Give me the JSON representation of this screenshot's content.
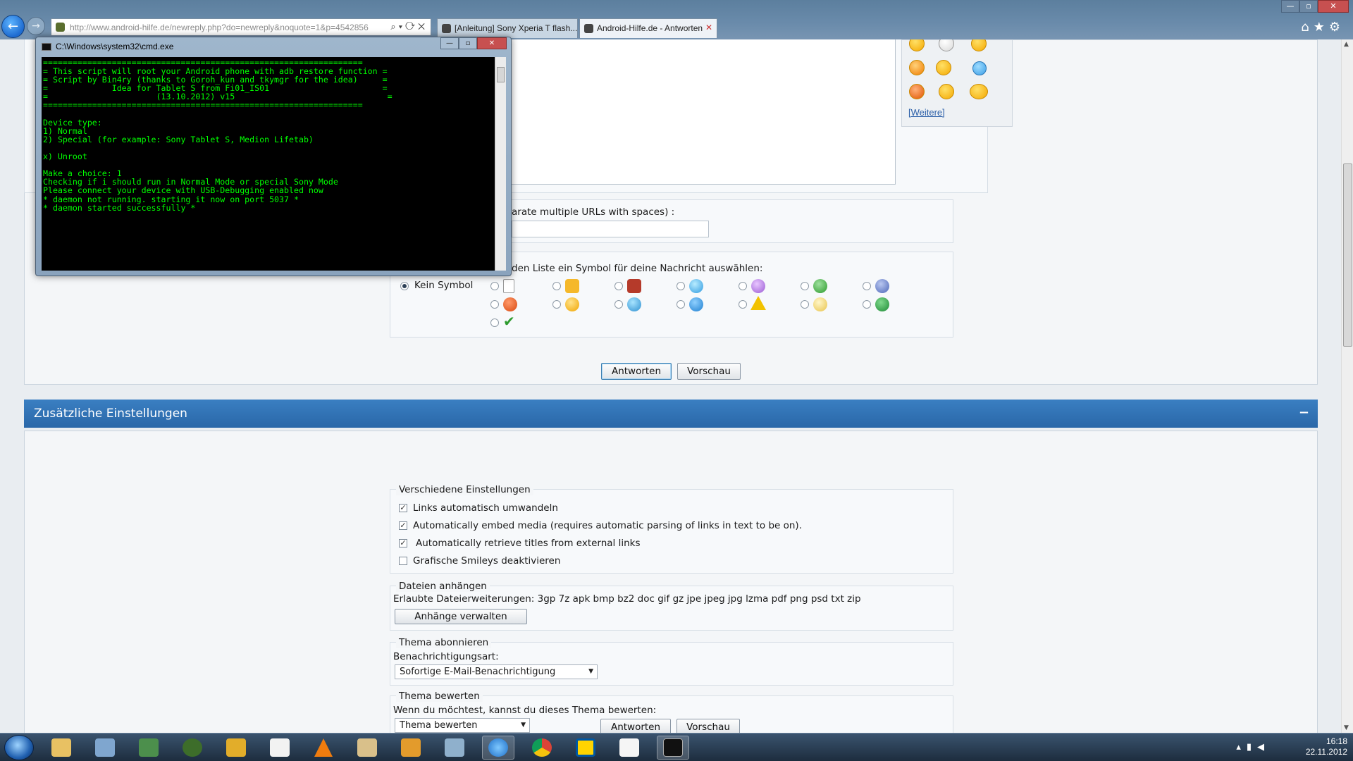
{
  "browser": {
    "url": "http://www.android-hilfe.de/newreply.php?do=newreply&noquote=1&p=4542856",
    "tabs": [
      {
        "label": "[Anleitung] Sony Xperia T flash..."
      },
      {
        "label": "Android-Hilfe.de - Antworten"
      }
    ]
  },
  "cmd": {
    "title": "C:\\Windows\\system32\\cmd.exe",
    "lines": [
      "=================================================================",
      "= This script will root your Android phone with adb restore function =",
      "= Script by Bin4ry (thanks to Goroh_kun and tkymgr for the idea)     =",
      "=             Idea for Tablet S from Fi01_IS01                       =",
      "=                      (13.10.2012) v15                               =",
      "=================================================================",
      "",
      "Device type:",
      "1) Normal",
      "2) Special (for example: Sony Tablet S, Medion Lifetab)",
      "",
      "x) Unroot",
      "",
      "Make a choice: 1",
      "Checking if i should run in Normal Mode or special Sony Mode",
      "Please connect your device with USB-Debugging enabled now",
      "* daemon not running. starting it now on port 5037 *",
      "* daemon started successfully *"
    ]
  },
  "form": {
    "smilies_more": "[Weitere]",
    "urls_label": "arate multiple URLs with spaces) :",
    "icon_prompt": "den Liste ein Symbol für deine Nachricht auswählen:",
    "no_icon": "Kein Symbol",
    "reply_button": "Antworten",
    "preview_button": "Vorschau"
  },
  "additional": {
    "header": "Zusätzliche Einstellungen",
    "toggle": "−",
    "misc": {
      "legend": "Verschiedene Einstellungen",
      "options": [
        {
          "label": "Links automatisch umwandeln",
          "checked": true
        },
        {
          "label": "Automatically embed media (requires automatic parsing of links in text to be on).",
          "checked": true
        },
        {
          "label": "Automatically retrieve titles from external links",
          "checked": true
        },
        {
          "label": "Grafische Smileys deaktivieren",
          "checked": false
        }
      ]
    },
    "attach": {
      "legend": "Dateien anhängen",
      "allowed": "Erlaubte Dateierweiterungen: 3gp 7z apk bmp bz2 doc gif gz jpe jpeg jpg lzma pdf png psd txt zip",
      "button": "Anhänge verwalten"
    },
    "subscribe": {
      "legend": "Thema abonnieren",
      "label": "Benachrichtigungsart:",
      "value": "Sofortige E-Mail-Benachrichtigung"
    },
    "rate": {
      "legend": "Thema bewerten",
      "label": "Wenn du möchtest, kannst du dieses Thema bewerten:",
      "value": "Thema bewerten"
    }
  },
  "taskbar": {
    "time": "16:18",
    "date": "22.11.2012"
  }
}
